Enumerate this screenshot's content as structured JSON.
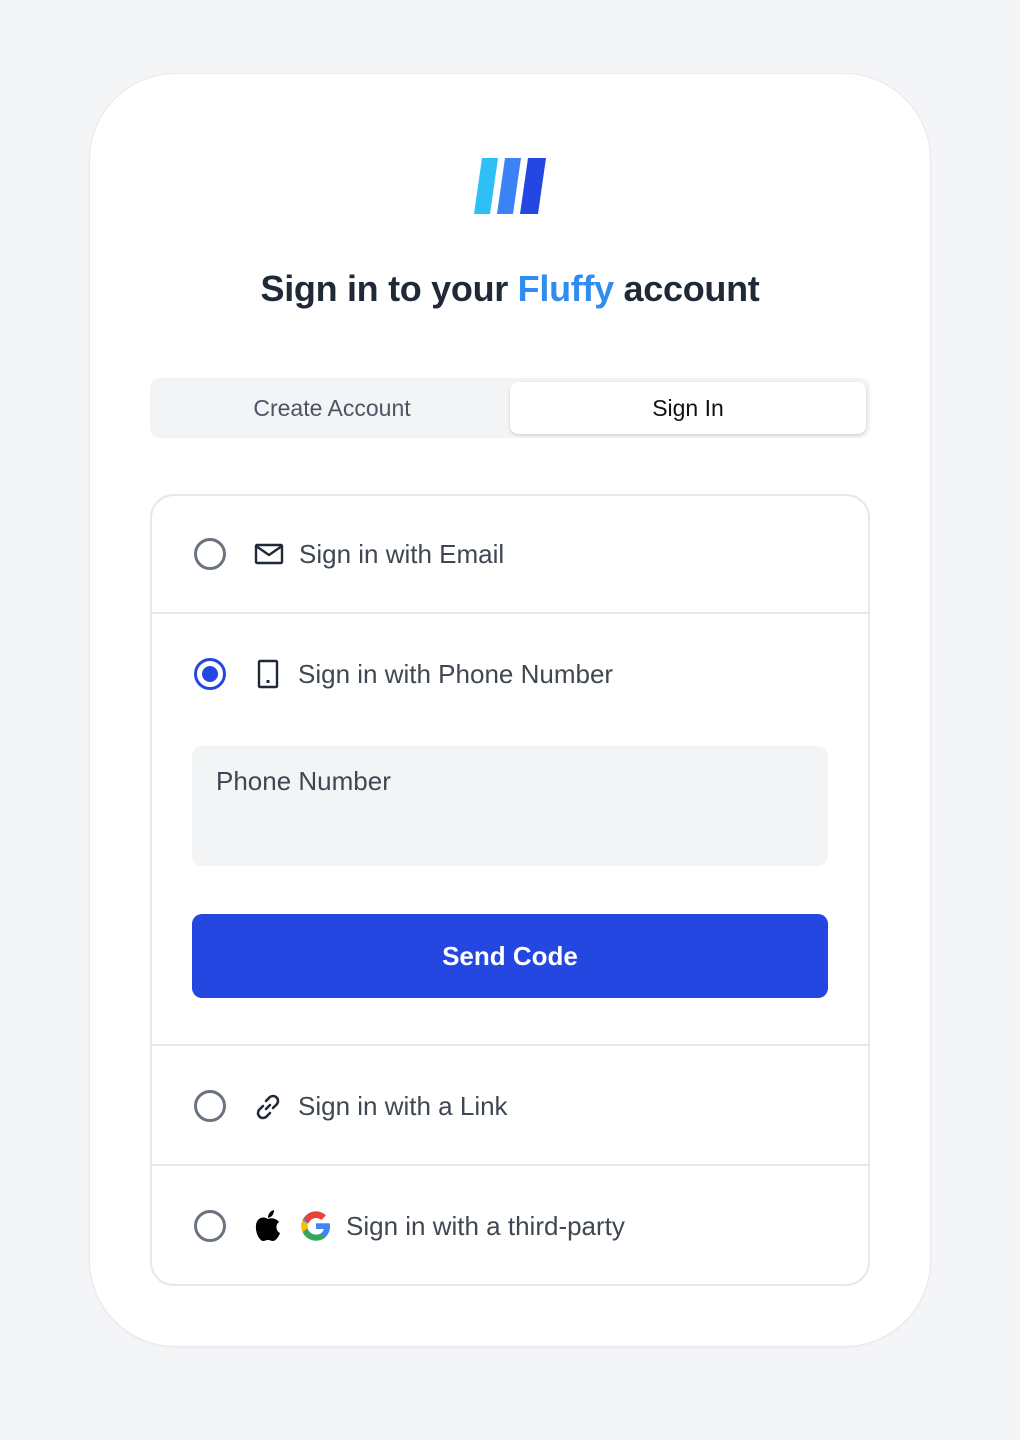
{
  "header": {
    "title_prefix": "Sign in to your ",
    "title_brand": "Fluffy",
    "title_suffix": " account",
    "brand_color": "#2f8cf0",
    "logo_icon": "fluffy-logo-stripes"
  },
  "tabs": [
    {
      "label": "Create Account",
      "active": false
    },
    {
      "label": "Sign In",
      "active": true
    }
  ],
  "options": [
    {
      "label": "Sign in with Email",
      "icon": "envelope-icon",
      "selected": false
    },
    {
      "label": "Sign in with Phone Number",
      "icon": "phone-icon",
      "selected": true
    },
    {
      "label": "Sign in with a Link",
      "icon": "link-icon",
      "selected": false
    },
    {
      "label": "Sign in with a third-party",
      "icons": [
        "apple-icon",
        "google-icon"
      ],
      "selected": false
    }
  ],
  "phone_form": {
    "placeholder": "Phone Number",
    "value": "",
    "submit_label": "Send Code"
  },
  "colors": {
    "accent": "#2447e1",
    "page_background": "#f4f5f7"
  }
}
